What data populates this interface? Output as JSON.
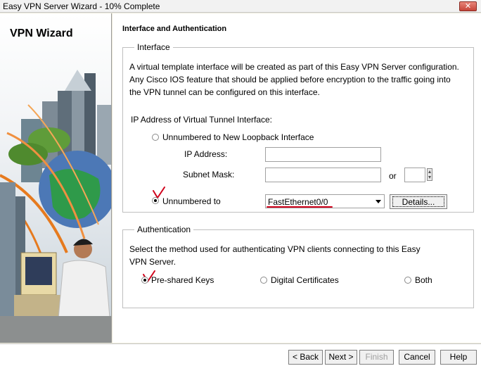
{
  "window": {
    "title": "Easy VPN Server Wizard - 10% Complete",
    "close_glyph": "✕"
  },
  "side": {
    "title": "VPN Wizard"
  },
  "page": {
    "header": "Interface and Authentication"
  },
  "interface_group": {
    "legend": "Interface",
    "description_lines": [
      "A virtual template interface will be created as part of this Easy VPN Server configuration.",
      "Any Cisco IOS feature that should be applied before encryption to the traffic going into",
      "the VPN tunnel can be configured on this interface."
    ],
    "ip_label": "IP Address of Virtual Tunnel Interface:",
    "option_loopback": "Unnumbered to New Loopback Interface",
    "ip_address_label": "IP Address:",
    "ip_address_value": "",
    "subnet_mask_label": "Subnet Mask:",
    "subnet_mask_value": "",
    "or_label": "or",
    "prefix_value": "",
    "option_unnumbered": "Unnumbered to",
    "interface_selected": "FastEthernet0/0",
    "details_button": "Details..."
  },
  "auth_group": {
    "legend": "Authentication",
    "description_lines": [
      "Select the method used for authenticating VPN clients connecting to this Easy",
      "VPN Server."
    ],
    "option_psk": "Pre-shared Keys",
    "option_certs": "Digital Certificates",
    "option_both": "Both"
  },
  "footer": {
    "back": "< Back",
    "next": "Next >",
    "finish": "Finish",
    "cancel": "Cancel",
    "help": "Help"
  },
  "colors": {
    "annotation_red": "#d0021b",
    "accent": "#0a246a"
  }
}
